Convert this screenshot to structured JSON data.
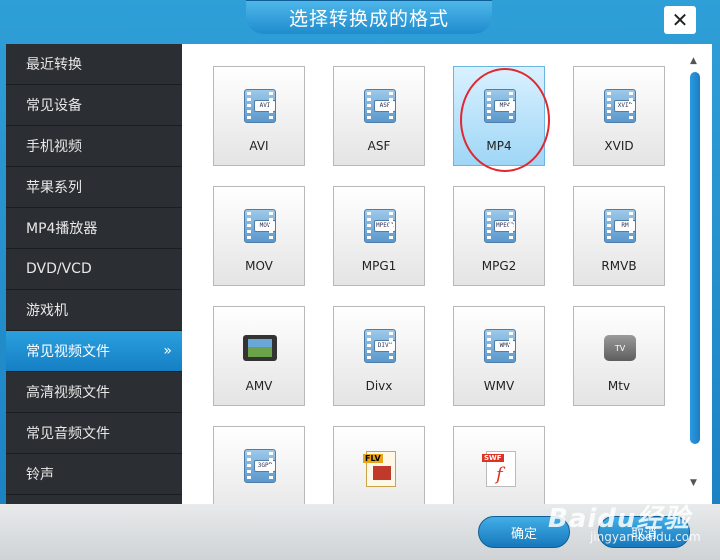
{
  "window": {
    "title": "选择转换成的格式",
    "close_label": "✕"
  },
  "sidebar": {
    "items": [
      {
        "label": "最近转换"
      },
      {
        "label": "常见设备"
      },
      {
        "label": "手机视频"
      },
      {
        "label": "苹果系列"
      },
      {
        "label": "MP4播放器"
      },
      {
        "label": "DVD/VCD"
      },
      {
        "label": "游戏机"
      },
      {
        "label": "常见视频文件",
        "active": true
      },
      {
        "label": "高清视频文件"
      },
      {
        "label": "常见音频文件"
      },
      {
        "label": "铃声"
      }
    ],
    "active_chevron": "»"
  },
  "formats": {
    "avi": {
      "label": "AVI",
      "tag": "AVI"
    },
    "asf": {
      "label": "ASF",
      "tag": "ASF"
    },
    "mp4": {
      "label": "MP4",
      "tag": "MP4"
    },
    "xvid": {
      "label": "XVID",
      "tag": "XVID"
    },
    "mov": {
      "label": "MOV",
      "tag": "MOV"
    },
    "mpg1": {
      "label": "MPG1",
      "tag": "MPEG1"
    },
    "mpg2": {
      "label": "MPG2",
      "tag": "MPEG2"
    },
    "rmvb": {
      "label": "RMVB",
      "tag": "RM"
    },
    "amv": {
      "label": "AMV"
    },
    "divx": {
      "label": "Divx",
      "tag": "DIVX"
    },
    "wmv": {
      "label": "WMV",
      "tag": "WMV"
    },
    "mtv": {
      "label": "Mtv",
      "tag": "TV"
    },
    "3gp": {
      "tag": "3GPP"
    },
    "flv": {
      "tag": "FLV"
    },
    "swf": {
      "tag": "SWF",
      "glyph": "f"
    }
  },
  "footer": {
    "ok_label": "确定",
    "cancel_label": "取消"
  },
  "watermark": {
    "brand": "Baidu经验",
    "url": "jingyan.baidu.com"
  },
  "colors": {
    "accent": "#1f8ccd",
    "sidebar_bg": "#2b2e32",
    "selected_tile": "#9fd6f6",
    "highlight_ring": "#e0282f"
  }
}
